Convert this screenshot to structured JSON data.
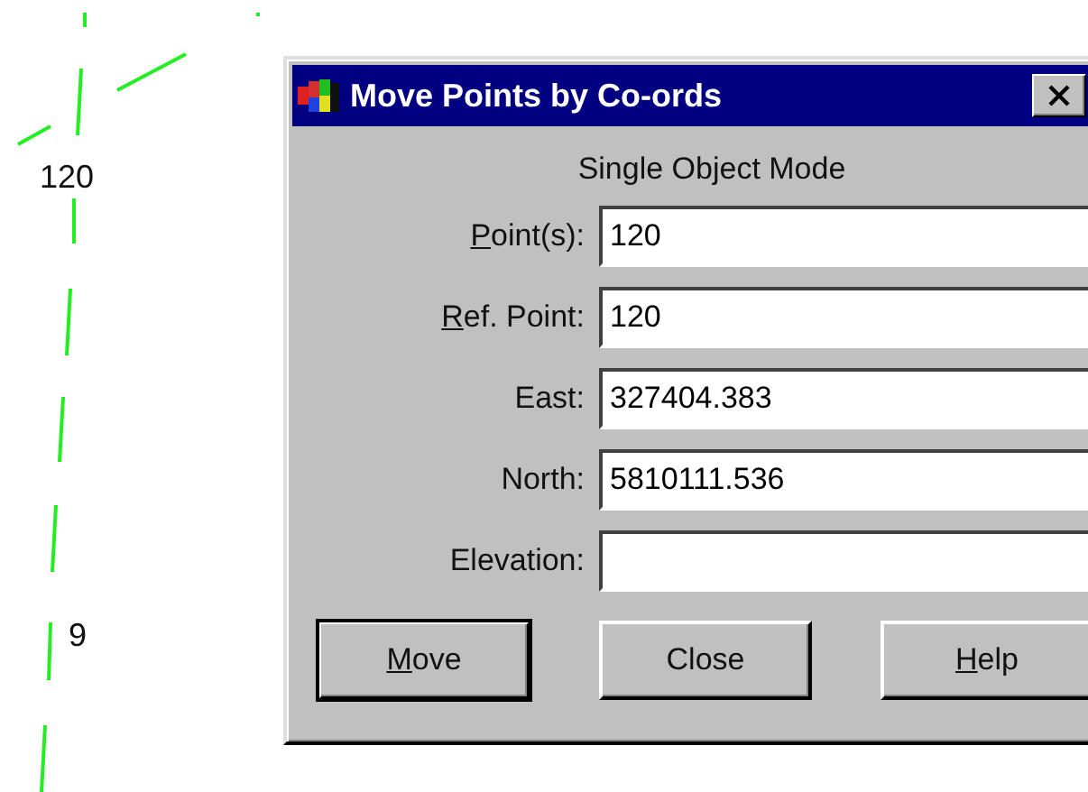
{
  "canvas": {
    "point_labels": [
      "120",
      "9"
    ]
  },
  "dialog": {
    "title": "Move Points by Co-ords",
    "mode": "Single Object Mode",
    "fields": [
      {
        "access_key": "P",
        "label_rest": "oint(s):",
        "value": "120"
      },
      {
        "access_key": "R",
        "label_rest": "ef. Point:",
        "value": "120"
      },
      {
        "label_rest": "East:",
        "value": "327404.383"
      },
      {
        "label_rest": "North:",
        "value": "5810111.536"
      },
      {
        "label_rest": "Elevation:"
      }
    ],
    "buttons": [
      {
        "access_key": "M",
        "label_rest": "ove",
        "default": true
      },
      {
        "label_rest": "Close",
        "default": false
      },
      {
        "access_key": "H",
        "label_rest": "elp",
        "default": false
      }
    ]
  }
}
